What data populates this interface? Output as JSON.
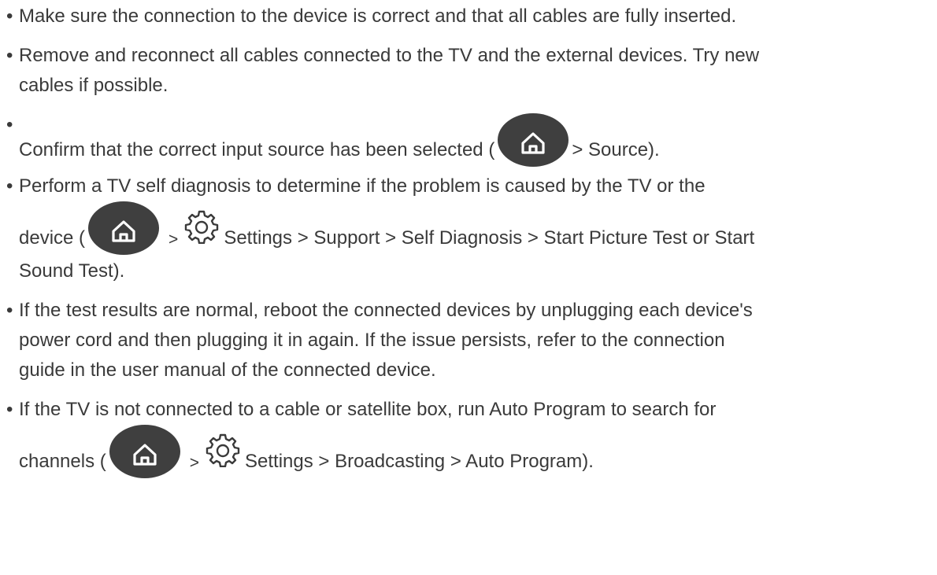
{
  "items": [
    {
      "text": "Make sure the connection to the device is correct and that all cables are fully inserted."
    },
    {
      "line1": "Remove and reconnect all cables connected to the TV and the external devices. Try new",
      "line2": "cables if possible."
    },
    {
      "prefix": "Confirm that the correct input source has been selected (",
      "suffix": "> Source)."
    },
    {
      "line1": "Perform a TV self diagnosis to determine if the problem is caused by the TV or the",
      "prefix": "device (",
      "sep": ">",
      "suffix": "Settings > Support > Self Diagnosis > Start Picture Test or Start",
      "line3": "Sound Test)."
    },
    {
      "line1": "If the test results are normal, reboot the connected devices by unplugging each device's",
      "line2": "power cord and then plugging it in again. If the issue persists, refer to the connection",
      "line3": "guide in the user manual of the connected device."
    },
    {
      "line1": "If the TV is not connected to a cable or satellite box, run Auto Program to search for",
      "prefix": "channels (",
      "sep": ">",
      "suffix": "Settings > Broadcasting > Auto Program)."
    }
  ],
  "bullet": "•",
  "icons": {
    "home": "home-icon",
    "settings": "gear-icon",
    "home_bg": "#3f3f3f",
    "home_fg": "#ffffff",
    "gear_color": "#3a3a3a"
  }
}
